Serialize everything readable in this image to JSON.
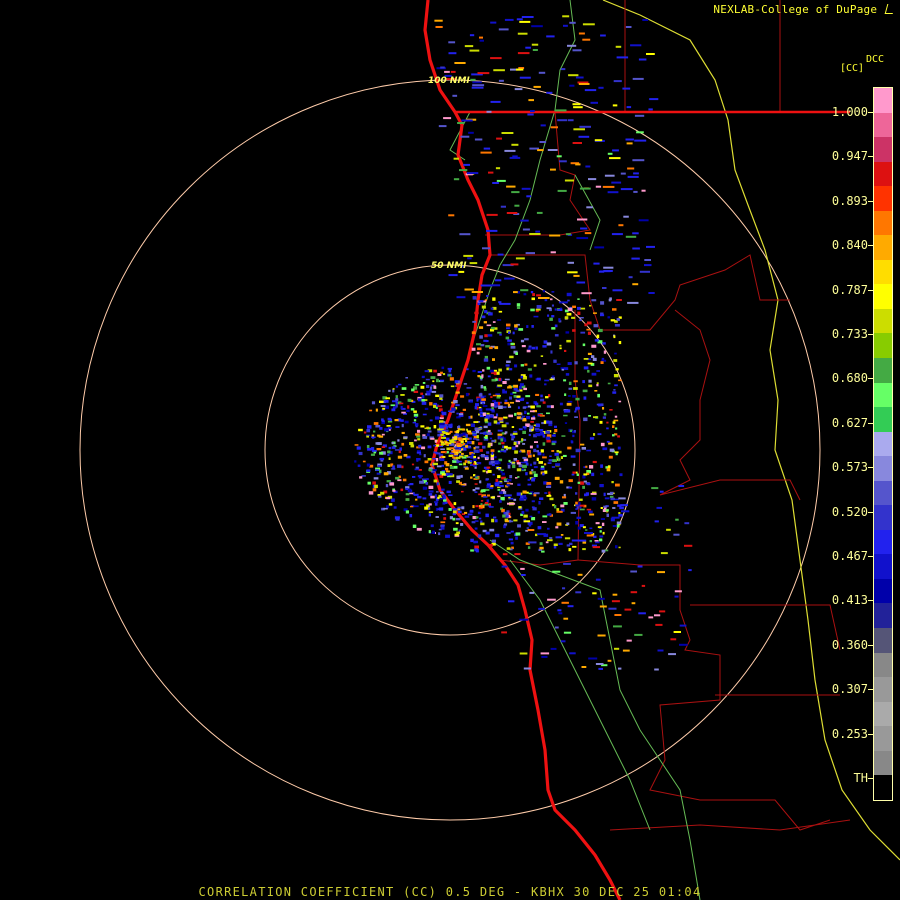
{
  "credit": "NEXLAB-College of DuPage",
  "credit_icon": "small-logo-icon",
  "legend": {
    "product": "DCC",
    "unit": "[CC]",
    "ticks": [
      "1.000",
      "0.947",
      "0.893",
      "0.840",
      "0.787",
      "0.733",
      "0.680",
      "0.627",
      "0.573",
      "0.520",
      "0.467",
      "0.413",
      "0.360",
      "0.307",
      "0.253",
      "TH"
    ],
    "colors": [
      "#ff99cc",
      "#ee6699",
      "#cc3366",
      "#dd1111",
      "#ff3300",
      "#ff7700",
      "#ffaa00",
      "#ffdd00",
      "#ffff00",
      "#ccdd00",
      "#88cc00",
      "#44aa44",
      "#66ff66",
      "#33cc55",
      "#aaaaee",
      "#8888dd",
      "#5555cc",
      "#3333cc",
      "#2222ee",
      "#1111cc",
      "#0000aa",
      "#222299",
      "#555577",
      "#888888",
      "#999999",
      "#aaaaaa",
      "#999999",
      "#888888",
      "#000000"
    ]
  },
  "range_rings": [
    "100 NMI",
    "50 NMI"
  ],
  "caption": "CORRELATION COEFFICIENT (CC) 0.5 DEG - KBHX 30 DEC 25 01:04"
}
